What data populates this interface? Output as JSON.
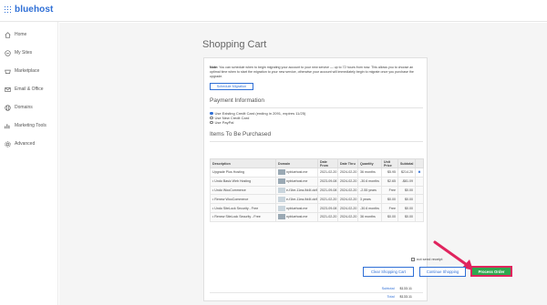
{
  "brand": {
    "name": "bluehost",
    "color": "#2f6fd6"
  },
  "sidebar": {
    "items": [
      {
        "label": "Home",
        "icon": "home-icon"
      },
      {
        "label": "My Sites",
        "icon": "sites-icon"
      },
      {
        "label": "Marketplace",
        "icon": "marketplace-icon"
      },
      {
        "label": "Email & Office",
        "icon": "email-icon"
      },
      {
        "label": "Domains",
        "icon": "globe-icon"
      },
      {
        "label": "Marketing Tools",
        "icon": "chart-icon"
      },
      {
        "label": "Advanced",
        "icon": "gear-icon"
      }
    ]
  },
  "page": {
    "title": "Shopping Cart"
  },
  "note": {
    "label": "Note:",
    "text": "You can schedule when to begin migrating your account to your new service — up to 72 hours from now. This allows you to choose an optimal time when to start the migration to your new service, otherwise your account will immediately begin to migrate once you purchase the upgrade.",
    "button": "Schedule Migration"
  },
  "payment": {
    "heading": "Payment Information",
    "options": [
      {
        "label": "Use Existing Credit Card (ending in 2091, expires 11/25)",
        "selected": true
      },
      {
        "label": "Use New Credit Card",
        "selected": false
      },
      {
        "label": "Use PayPal",
        "selected": false
      }
    ]
  },
  "items": {
    "heading": "Items To Be Purchased",
    "columns": [
      "Description",
      "Domain",
      "Date From",
      "Date Thru",
      "Quantity",
      "Unit Price",
      "Subtotal"
    ],
    "rows": [
      {
        "desc": "Upgrade Plus Hosting",
        "domain": "nybluehost.me",
        "from": "2021-02-20",
        "thru": "2024-02-20",
        "qty": "36 months",
        "unit": "$5.95",
        "sub": "$214.20",
        "remove": "✖"
      },
      {
        "desc": "• Undo Basic Web Hosting",
        "domain": "nybluehost.me",
        "from": "2023-09-08",
        "thru": "2024-02-20",
        "qty": "-30.6 months",
        "unit": "$2.65",
        "sub": "-$81.09",
        "remove": ""
      },
      {
        "desc": "• Undo WooCommerce",
        "domain": "e-f1be-11ea-9d4f-dc98d4dd5ea",
        "from": "2021-09-08",
        "thru": "2024-02-20",
        "qty": "-2.55 years",
        "unit": "Free",
        "sub": "$0.00",
        "remove": ""
      },
      {
        "desc": "• Renew WooCommerce",
        "domain": "e-f1be-11ea-9d4f-dc98d4dd5ea",
        "from": "2021-02-20",
        "thru": "2024-02-20",
        "qty": "3 years",
        "unit": "$0.00",
        "sub": "$0.00",
        "remove": ""
      },
      {
        "desc": "• Undo SiteLock Security - Free",
        "domain": "nybluehost.me",
        "from": "2023-09-08",
        "thru": "2024-02-20",
        "qty": "-30.6 months",
        "unit": "Free",
        "sub": "$0.00",
        "remove": ""
      },
      {
        "desc": "• Renew SiteLock Security - Free",
        "domain": "nybluehost.me",
        "from": "2021-02-20",
        "thru": "2024-02-20",
        "qty": "36 months",
        "unit": "$0.00",
        "sub": "$0.00",
        "remove": ""
      }
    ]
  },
  "totals": {
    "subtotal_label": "Subtotal",
    "subtotal": "$133.11",
    "total_label": "Total",
    "total": "$133.11"
  },
  "receipt": {
    "label": "not send receipt"
  },
  "actions": {
    "clear": "Clear Shopping Cart",
    "continue": "Continue Shopping",
    "process": "Process Order"
  },
  "colors": {
    "accent": "#2f6fd6",
    "process": "#2fa84f",
    "highlight": "#e0245e"
  }
}
